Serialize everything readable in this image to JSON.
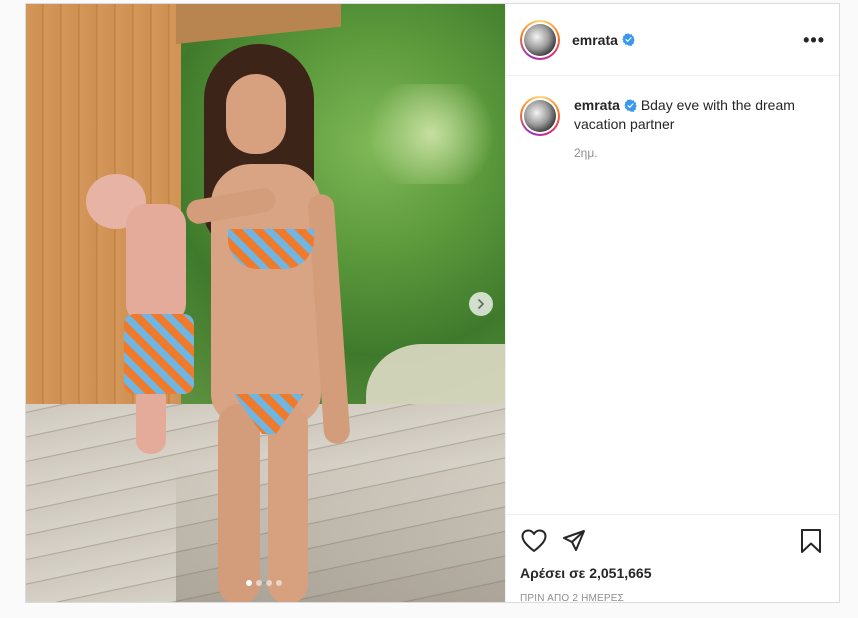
{
  "post": {
    "username": "emrata",
    "verified": true,
    "caption_text": "Bday eve with the dream vacation partner",
    "relative_time": "2ημ.",
    "likes_text": "Αρέσει σε 2,051,665",
    "timestamp_text": "ΠΡΙΝ ΑΠΟ 2 ΗΜΕΡΕΣ",
    "more_symbol": "•••"
  },
  "carousel": {
    "slide_count": 4,
    "active_index": 0
  },
  "icons": {
    "verified": "verified-badge-icon",
    "like": "heart-icon",
    "share": "paper-plane-icon",
    "save": "bookmark-icon",
    "next": "chevron-right-icon"
  },
  "colors": {
    "verified_blue": "#3897f0",
    "text": "#262626",
    "muted": "#8e8e8e",
    "border": "#dbdbdb"
  }
}
